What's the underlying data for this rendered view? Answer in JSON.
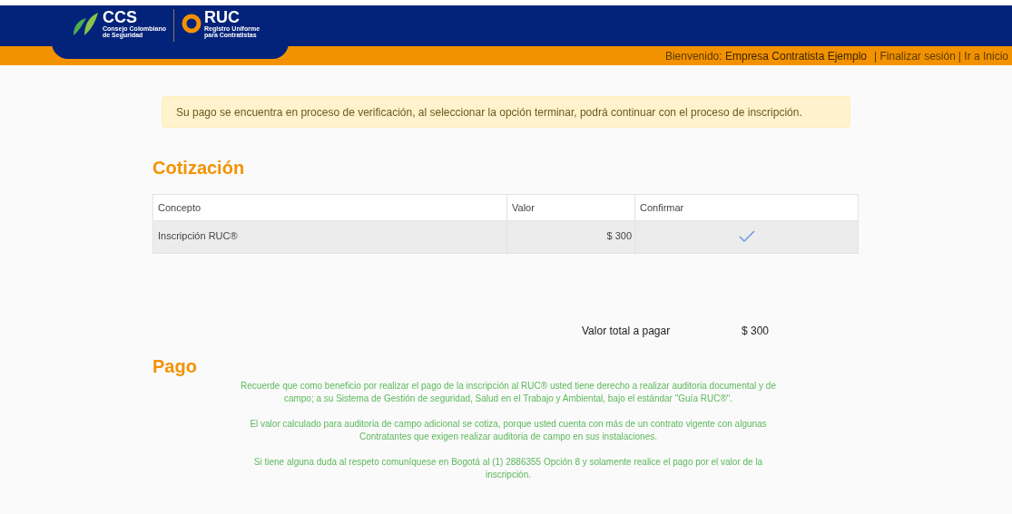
{
  "header": {
    "logo_ccs": {
      "title": "CCS",
      "subtitle_1": "Consejo Colombiano",
      "subtitle_2": "de Seguridad"
    },
    "logo_ruc": {
      "title": "RUC",
      "subtitle_1": "Registro Uniforme",
      "subtitle_2": "para Contratistas"
    },
    "welcome_label": "Bienvenido:",
    "user": "Empresa Contratista Ejemplo",
    "links": [
      "| Finalizar sesión",
      "| Ir a Inicio"
    ]
  },
  "alert": "Su pago se encuentra en proceso de verificación, al seleccionar la opción terminar, podrá continuar con el proceso de inscripción.",
  "quote": {
    "title": "Cotización",
    "columns": [
      "Concepto",
      "Valor",
      "Confirmar"
    ],
    "rows": [
      {
        "concept": "Inscripción RUC®",
        "value": "$ 300",
        "confirmed": true
      }
    ],
    "total_label": "Valor total a pagar",
    "total": "$ 300"
  },
  "payment": {
    "title": "Pago",
    "paragraphs": [
      "Recuerde que como beneficio por realizar el pago de la inscripción al RUC® usted tiene derecho a realizar auditoria documental y de campo; a su Sistema de Gestión de seguridad, Salud en el Trabajo y Ambiental, bajo el estándar \"Guía RUC®\".",
      "El valor calculado para auditoria de campo adicional se cotiza, porque usted cuenta con más de un contrato vigente con algunas Contratantes que exigen realizar auditoria de campo en sus instalaciones.",
      "Si tiene alguna duda al respeto comuníquese en Bogotá al (1) 2886355 Opción 8 y solamente realice el pago por el valor de la inscripción."
    ]
  }
}
